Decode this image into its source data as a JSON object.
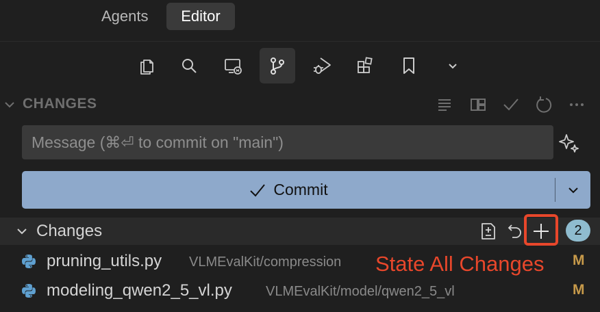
{
  "tabs": {
    "agents_label": "Agents",
    "editor_label": "Editor"
  },
  "toolbar": {
    "items": [
      "explorer-icon",
      "search-icon",
      "remote-explorer-icon",
      "source-control-icon",
      "run-debug-icon",
      "extensions-icon",
      "bookmarks-icon",
      "more-chevron-icon"
    ],
    "active": "source-control-icon"
  },
  "section": {
    "title": "CHANGES",
    "actions": [
      "view-as-list-icon",
      "view-as-tree-icon",
      "check-icon",
      "refresh-icon",
      "more-actions-icon"
    ]
  },
  "commit": {
    "message_placeholder": "Message (⌘⏎ to commit on \"main\")",
    "message_value": "",
    "button_label": "Commit"
  },
  "changes_group": {
    "label": "Changes",
    "count": "2",
    "actions": [
      "open-changes-icon",
      "discard-all-icon",
      "stage-all-icon"
    ]
  },
  "files": [
    {
      "name": "pruning_utils.py",
      "path": "VLMEvalKit/compression",
      "status": "M"
    },
    {
      "name": "modeling_qwen2_5_vl.py",
      "path": "VLMEvalKit/model/qwen2_5_vl",
      "status": "M"
    }
  ],
  "annotation": {
    "text": "State All Changes"
  },
  "colors": {
    "background": "#1f1f1f",
    "commit_button": "#8ea9cb",
    "highlight": "#e8472b",
    "badge": "#8fbccf",
    "modified": "#c79a4a"
  }
}
